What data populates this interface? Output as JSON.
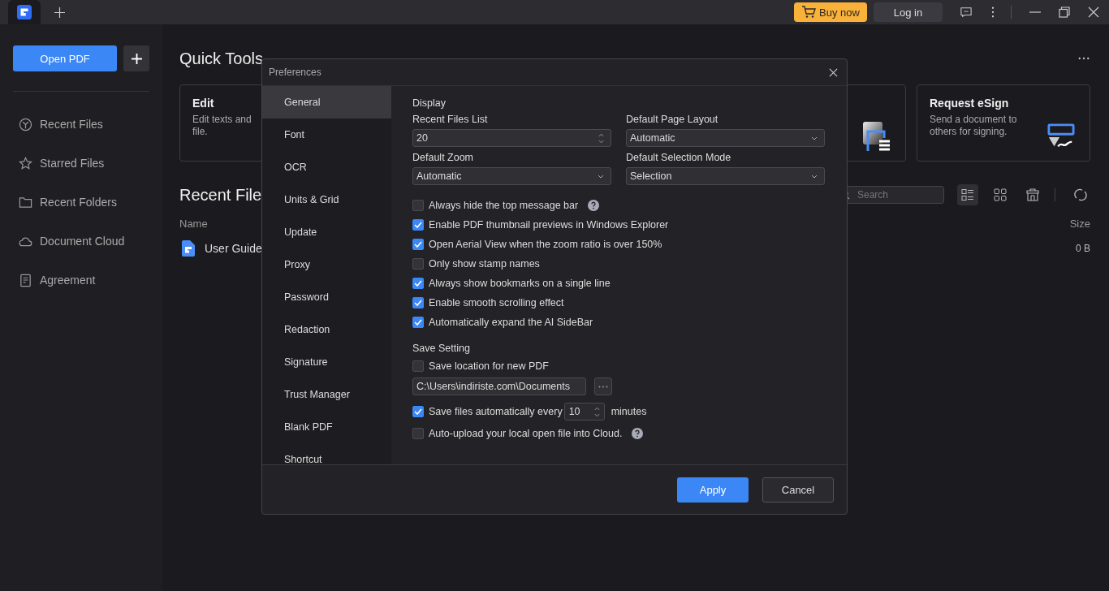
{
  "title_bar": {
    "tabs": [
      {
        "selected": true
      }
    ],
    "buy_button": "Buy now",
    "login_button": "Log in"
  },
  "sidebar": {
    "open_button": "Open PDF",
    "items": [
      {
        "kind": "clock",
        "label": "Recent Files",
        "selected": false
      },
      {
        "kind": "star",
        "label": "Starred Files",
        "selected": false
      },
      {
        "kind": "folder",
        "label": "Recent Folders",
        "selected": false
      },
      {
        "kind": "cloud",
        "label": "Document Cloud",
        "selected": false
      },
      {
        "kind": "doc",
        "label": "Agreement",
        "selected": false
      }
    ]
  },
  "quick_tools": {
    "title": "Quick Tools",
    "cards": [
      {
        "kind": "text",
        "title": "Edit",
        "lines": [
          "Edit texts and",
          "file."
        ]
      },
      {
        "kind": "art"
      },
      {
        "kind": "esign",
        "title": "Request eSign",
        "lines": [
          "Send a document to",
          "others for signing."
        ]
      }
    ]
  },
  "recent_files": {
    "title": "Recent File",
    "search": {
      "placeholder": "Search"
    },
    "view_modes": [
      {
        "kind": "list",
        "selected": true
      },
      {
        "kind": "grid",
        "selected": false
      }
    ],
    "columns": [
      "Name",
      "Size"
    ],
    "rows": [
      {
        "name": "User Guide",
        "size": "0 B"
      }
    ]
  },
  "dialog": {
    "title": "Preferences",
    "nav": [
      {
        "label": "General",
        "selected": true
      },
      {
        "label": "Font",
        "selected": false
      },
      {
        "label": "OCR",
        "selected": false
      },
      {
        "label": "Units & Grid",
        "selected": false
      },
      {
        "label": "Update",
        "selected": false
      },
      {
        "label": "Proxy",
        "selected": false
      },
      {
        "label": "Password",
        "selected": false
      },
      {
        "label": "Redaction",
        "selected": false
      },
      {
        "label": "Signature",
        "selected": false
      },
      {
        "label": "Trust Manager",
        "selected": false
      },
      {
        "label": "Blank PDF",
        "selected": false
      },
      {
        "label": "Shortcut",
        "selected": false
      }
    ],
    "display": {
      "title": "Display",
      "fields": [
        {
          "kind": "spin",
          "label": "Recent Files List",
          "value": "20"
        },
        {
          "kind": "select",
          "label": "Default Page Layout",
          "value": "Automatic"
        },
        {
          "kind": "select",
          "label": "Default Zoom",
          "value": "Automatic"
        },
        {
          "kind": "select",
          "label": "Default Selection Mode",
          "value": "Selection"
        }
      ],
      "options": [
        {
          "label": "Always hide the top message bar",
          "checked": false,
          "help": true
        },
        {
          "label": "Enable PDF thumbnail previews in Windows Explorer",
          "checked": true,
          "help": false
        },
        {
          "label": "Open Aerial View when the zoom ratio is over 150%",
          "checked": true,
          "help": false
        },
        {
          "label": "Only show stamp names",
          "checked": false,
          "help": false
        },
        {
          "label": "Always show bookmarks on a single line",
          "checked": true,
          "help": false
        },
        {
          "label": "Enable smooth scrolling effect",
          "checked": true,
          "help": false
        },
        {
          "label": "Automatically expand the AI SideBar",
          "checked": true,
          "help": false
        }
      ]
    },
    "save_setting": {
      "title": "Save Setting",
      "location": {
        "label": "Save location for new PDF",
        "checked": false,
        "help": false
      },
      "path": "C:\\Users\\indiriste.com\\Documents",
      "autosave": {
        "label": "Save files automatically every",
        "checked": true,
        "value": "10",
        "unit": "minutes"
      },
      "upload": {
        "label": "Auto-upload your local open file into Cloud.",
        "checked": false,
        "help": true
      }
    },
    "buttons": {
      "apply": "Apply",
      "cancel": "Cancel"
    }
  }
}
